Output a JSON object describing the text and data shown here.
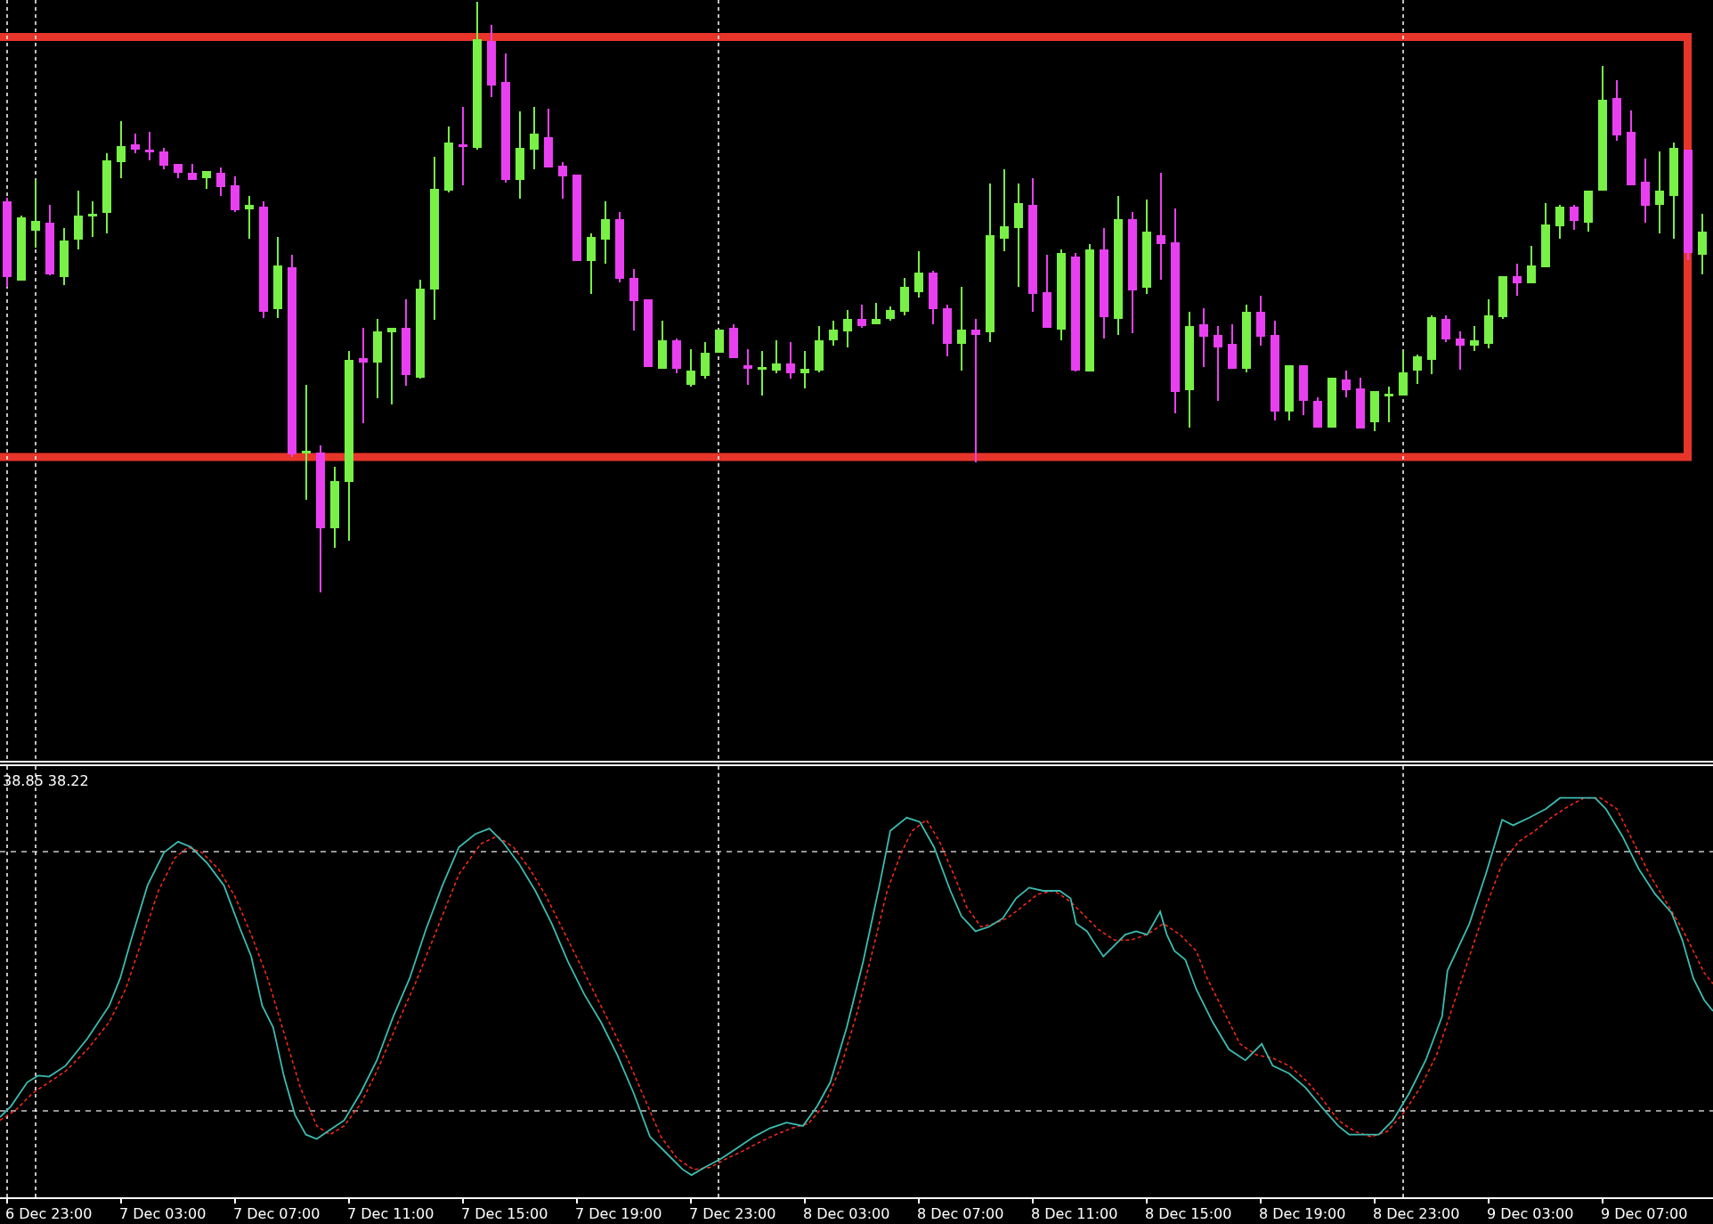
{
  "indicator_window": {
    "values": [
      "38.85",
      "38.22"
    ]
  },
  "time_axis": {
    "labels": [
      "6 Dec 23:00",
      "7 Dec 03:00",
      "7 Dec 07:00",
      "7 Dec 11:00",
      "7 Dec 15:00",
      "7 Dec 19:00",
      "7 Dec 23:00",
      "8 Dec 03:00",
      "8 Dec 07:00",
      "8 Dec 11:00",
      "8 Dec 15:00",
      "8 Dec 19:00",
      "8 Dec 23:00",
      "9 Dec 03:00",
      "9 Dec 07:00"
    ]
  }
}
